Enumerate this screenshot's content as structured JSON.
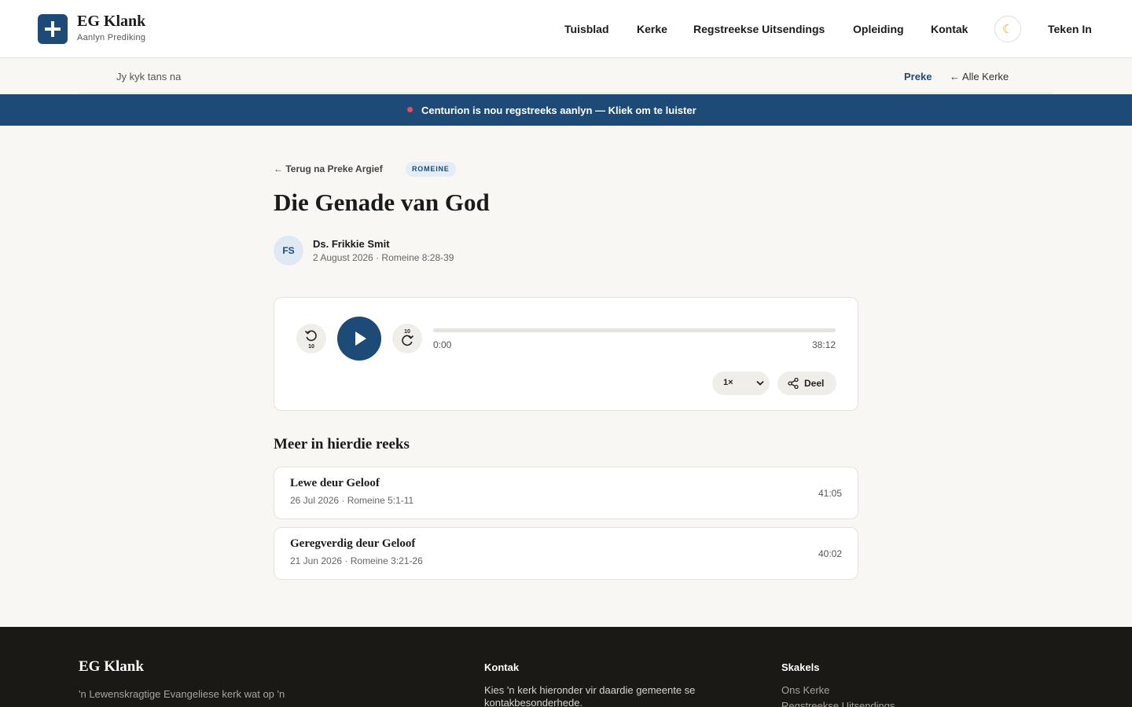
{
  "header": {
    "brand_name": "EG Klank",
    "brand_sub": "Aanlyn Prediking",
    "nav": [
      "Tuisblad",
      "Kerke",
      "Regstreekse Uitsendings",
      "Opleiding",
      "Kontak"
    ],
    "theme_icon": "moon-icon",
    "sign_in": "Teken In"
  },
  "subbar": {
    "label": "Jy kyk tans na",
    "current": "Preke",
    "all_link": "← Alle Kerke"
  },
  "live_banner": {
    "text": "Centurion is nou regstreeks aanlyn — Kliek om te luister",
    "dot_color": "#e2505a"
  },
  "sermon": {
    "back_link": "← Terug na Preke Argief",
    "book_badge": "ROMEINE",
    "title": "Die Genade van God",
    "speaker_initials": "FS",
    "speaker": "Ds. Frikkie Smit",
    "meta": "2 August 2026 · Romeine 8:28-39"
  },
  "player": {
    "skip_back_label": "10",
    "skip_forward_label": "10",
    "current_time": "0:00",
    "total_time": "38:12",
    "progress": 0,
    "speed": "1×",
    "share_label": "Deel"
  },
  "series": {
    "heading": "Meer in hierdie reeks",
    "items": [
      {
        "title": "Lewe deur Geloof",
        "meta": "26 Jul 2026 · Romeine 5:1-11",
        "duration": "41:05"
      },
      {
        "title": "Geregverdig deur Geloof",
        "meta": "21 Jun 2026 · Romeine 3:21-26",
        "duration": "40:02"
      }
    ]
  },
  "footer": {
    "brand": "EG Klank",
    "tagline": "'n Lewenskragtige Evangeliese kerk wat op 'n",
    "contact_heading": "Kontak",
    "contact_text": "Kies 'n kerk hieronder vir daardie gemeente se kontakbesonderhede.",
    "links_heading": "Skakels",
    "links": [
      "Ons Kerke",
      "Regstreekse Uitsendings"
    ]
  },
  "colors": {
    "brand": "#1d4a76",
    "background": "#f8f7f4",
    "footer": "#1a1916"
  }
}
